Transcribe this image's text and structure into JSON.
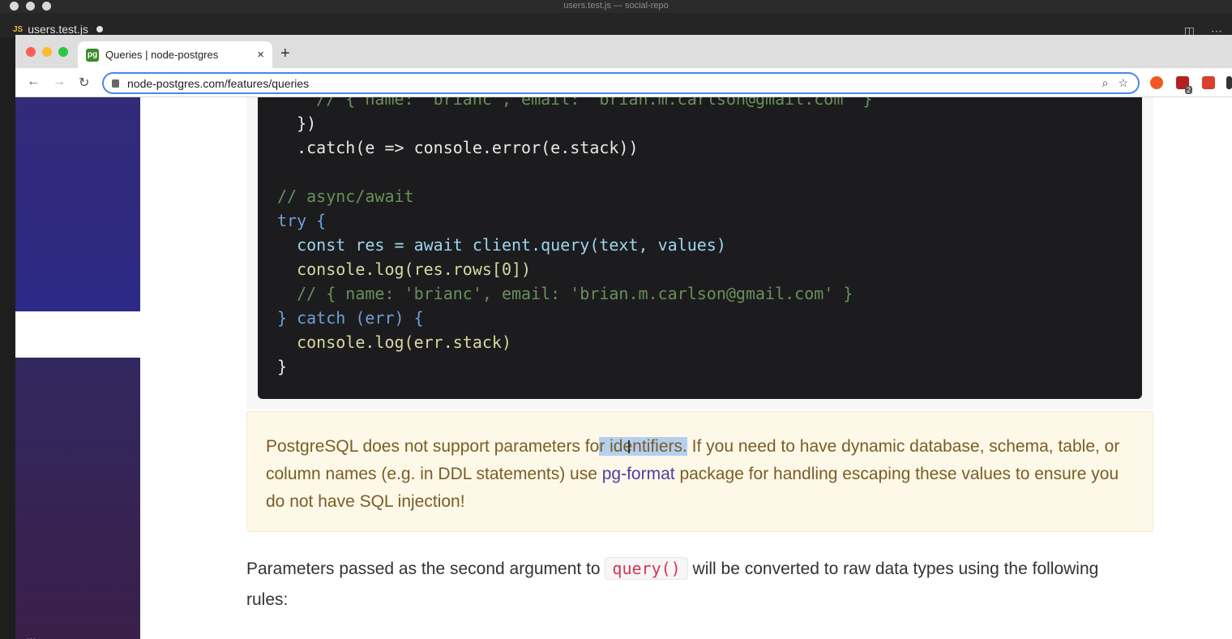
{
  "os": {
    "window_title": "users.test.js — social-repo"
  },
  "vscode": {
    "tab_icon": "JS",
    "tab_label": "users.test.js"
  },
  "browser": {
    "tab_title": "Queries | node-postgres",
    "tab_close": "×",
    "new_tab": "+",
    "url": "node-postgres.com/features/queries",
    "back": "←",
    "forward": "→",
    "reload": "↻",
    "zoom_icon": "⌕",
    "star_icon": "☆",
    "extension_badge": "2"
  },
  "code": {
    "lines": [
      "    // { name: 'brianc', email: 'brian.m.carlson@gmail.com' }",
      "  })",
      "  .catch(e => console.error(e.stack))",
      "",
      "// async/await",
      "try {",
      "  const res = await client.query(text, values)",
      "  console.log(res.rows[0])",
      "  // { name: 'brianc', email: 'brian.m.carlson@gmail.com' }",
      "} catch (err) {",
      "  console.log(err.stack)",
      "}"
    ]
  },
  "warning": {
    "before": "PostgreSQL does not support parameters fo",
    "highlight": "r identifiers.",
    "after": " If you need to have dynamic database, schema, table, or column names (e.g. in DDL statements) use ",
    "link": "pg-format",
    "tail": " package for handling escaping these values to ensure you do not have SQL injection!"
  },
  "paragraph": {
    "before": "Parameters passed as the second argument to ",
    "code": "query()",
    "after": " will be converted to raw data types using the following rules:"
  },
  "sidebar": {
    "bottom_text": "..."
  },
  "colors": {
    "sidebar": "#2c2a86",
    "warning_bg": "#fdf8e8",
    "link": "#4d3fa0",
    "code_bg": "#1c1c1e"
  }
}
